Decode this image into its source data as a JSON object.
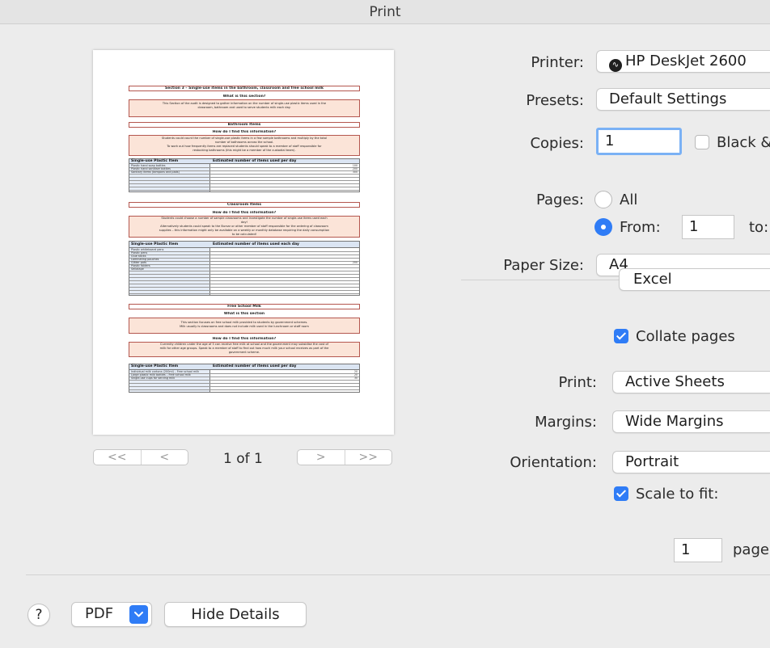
{
  "window": {
    "title": "Print"
  },
  "preview": {
    "page_indicator": "1 of 1",
    "nav": {
      "first": "<<",
      "prev": "<",
      "next": ">",
      "last": ">>"
    },
    "document": {
      "section_title": "Section 3 – Single-use items in the bathroom, classroom and free school milk",
      "what_heading": "What is this section?",
      "what_text_1": "This Section of the audit is designed to gather information on the number of single-use plastic items used in the",
      "what_text_2": "classroom, bathroom and used to serve students milk each day.",
      "bathroom_title": "Bathroom Items",
      "find_heading": "How do I find this information?",
      "bath_text_1": "Students could count the number of single-use plastic items in a few sample bathrooms and multiply by the total",
      "bath_text_2": "number of bathrooms across the school.",
      "bath_text_3": "To work out how frequently items are replaced students should speak to a member of staff responsible for",
      "bath_text_4": "restocking bathrooms (this might be a member of the custodial team).",
      "table_header_item": "Single-use Plastic Item",
      "table_header_estimate": "Estimated number of items used per day",
      "table_header_estimate_each": "Estimated number of items used each day",
      "bath_rows": [
        "Plastic hand soap bottles",
        "Plastic hand sanitiser bottles",
        "Sanitary items (tampons and pads)"
      ],
      "bath_values": [
        "100",
        "200",
        "300"
      ],
      "classroom_title": "Classroom Items",
      "class_text_1": "Students could choose a number of sample classrooms and investigate the number of single-use items used each",
      "class_text_2": "day!",
      "class_text_3": "Alternatively students could speak to the Bursar or other member of staff responsible for the ordering of classroom",
      "class_text_4": "supplies – this information might only be available on a weekly or monthly database requiring the daily consumption",
      "class_text_5": "to be calculated!",
      "class_rows": [
        "Plastic whiteboard pens",
        "Plastic pens",
        "Glue sticks",
        "Laminating pouches",
        "Glitter pots",
        "Plastic folders",
        "Sellotape"
      ],
      "class_values": [
        "",
        "",
        "",
        "",
        "200",
        "",
        ""
      ],
      "milk_title": "Free School Milk",
      "milk_what_heading": "What is this section",
      "milk_text_1": "This section focuses on free school milk provided to students by government schemes.",
      "milk_text_2": "Milk usually is classrooms and does not include milk used in the lunchroom or staff room",
      "milk_find_text_1": "Currently children under the age of 5 can receive free milk at school and the government may subsidise the cost of",
      "milk_find_text_2": "milk for other age groups. Speak to a member of staff to find out how much milk your school receives as part of the",
      "milk_find_text_3": "government scheme.",
      "milk_rows": [
        "Individual milk cartons (200ml) – Free school milk",
        "Large plastic milk bottles – Free school milk",
        "Single-use cups for serving milk"
      ],
      "milk_values": [
        "20",
        "20",
        "30"
      ]
    }
  },
  "settings": {
    "printer": {
      "label": "Printer:",
      "value": "HP DeskJet 2600"
    },
    "presets": {
      "label": "Presets:",
      "value": "Default Settings"
    },
    "copies": {
      "label": "Copies:",
      "value": "1",
      "bw_label": "Black &"
    },
    "pages": {
      "label": "Pages:",
      "all_label": "All",
      "from_label": "From:",
      "from_value": "1",
      "to_label": "to:"
    },
    "paper_size": {
      "label": "Paper Size:",
      "value": "A4"
    },
    "app_section": {
      "value": "Excel"
    },
    "collate": {
      "label": "Collate pages",
      "checked": true
    },
    "print": {
      "label": "Print:",
      "value": "Active Sheets"
    },
    "margins": {
      "label": "Margins:",
      "value": "Wide Margins"
    },
    "orientation": {
      "label": "Orientation:",
      "value": "Portrait"
    },
    "scale": {
      "label": "Scale to fit:",
      "checked": true,
      "value": "1",
      "unit": "page"
    }
  },
  "footer": {
    "help": "?",
    "pdf": "PDF",
    "pdf_arrow": "chevron-down-icon",
    "hide_details": "Hide Details"
  },
  "colors": {
    "accent": "#2f7cf6",
    "window_bg": "#ececec"
  }
}
